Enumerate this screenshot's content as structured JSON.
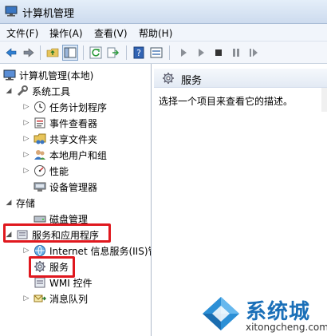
{
  "window": {
    "title": "计算机管理"
  },
  "menu": [
    "文件(F)",
    "操作(A)",
    "查看(V)",
    "帮助(H)"
  ],
  "toolbar": {
    "buttons": [
      "back-arrow-icon",
      "forward-arrow-icon",
      "up-folder-icon",
      "show-hide-tree-icon",
      "refresh-icon",
      "export-icon",
      "help-icon",
      "properties-icon",
      "play-icon",
      "play-alt-icon",
      "stop-icon",
      "pause-icon",
      "resume-icon"
    ]
  },
  "tree": {
    "root": "计算机管理(本地)",
    "system_tools": "系统工具",
    "task_scheduler": "任务计划程序",
    "event_viewer": "事件查看器",
    "shared_folders": "共享文件夹",
    "local_users": "本地用户和组",
    "performance": "性能",
    "device_manager": "设备管理器",
    "storage": "存储",
    "disk_management": "磁盘管理",
    "services_apps": "服务和应用程序",
    "iis": "Internet 信息服务(IIS)管",
    "services": "服务",
    "wmi": "WMI 控件",
    "message_queue": "消息队列"
  },
  "detail": {
    "header": "服务",
    "description": "选择一个项目来查看它的描述。"
  },
  "watermark": {
    "brand": "系统城",
    "url": "xitongcheng.com"
  },
  "colors": {
    "highlight": "#e0181e",
    "accent": "#1a6fb8"
  }
}
